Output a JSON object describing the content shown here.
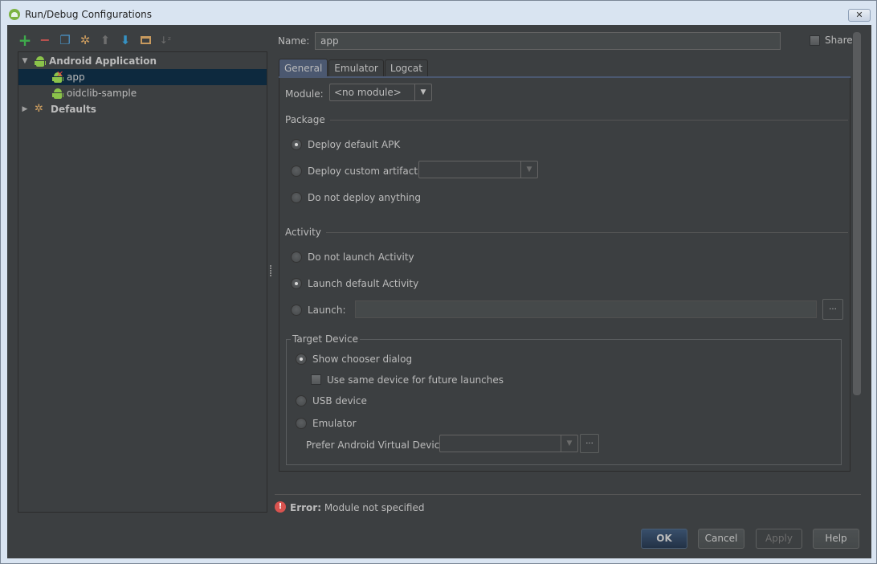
{
  "window": {
    "title": "Run/Debug Configurations",
    "close_label": "✕"
  },
  "toolbar": {
    "items": [
      {
        "name": "add",
        "glyph": "+",
        "color": "#3eaa4b"
      },
      {
        "name": "remove",
        "glyph": "—",
        "color": "#c75450"
      },
      {
        "name": "copy",
        "glyph": "⎘",
        "color": "#4a8fc1"
      },
      {
        "name": "edit-defaults",
        "glyph": "✲",
        "color": "#c89a5e"
      },
      {
        "name": "move-up",
        "glyph": "⬆",
        "color": "#6e6e6e"
      },
      {
        "name": "move-down",
        "glyph": "⬇",
        "color": "#3592c4"
      },
      {
        "name": "folder",
        "glyph": "▭",
        "color": "#c89a5e"
      },
      {
        "name": "sort",
        "glyph": "↓ᶻ",
        "color": "#6e6e6e"
      }
    ]
  },
  "tree": {
    "items": [
      {
        "label": "Android Application",
        "expanded": true,
        "bold": true,
        "level": 0
      },
      {
        "label": "app",
        "level": 1,
        "selected": true,
        "error": true
      },
      {
        "label": "oidclib-sample",
        "level": 1
      },
      {
        "label": "Defaults",
        "expanded": false,
        "bold": true,
        "level": 0
      }
    ]
  },
  "form": {
    "name_label": "Name:",
    "name_value": "app",
    "share_label": "Share",
    "share_checked": false,
    "tabs": [
      {
        "label": "General",
        "active": true
      },
      {
        "label": "Emulator",
        "active": false
      },
      {
        "label": "Logcat",
        "active": false
      }
    ],
    "module_label": "Module:",
    "module_value": "<no module>",
    "package": {
      "title": "Package",
      "options": [
        {
          "label": "Deploy default APK",
          "selected": true
        },
        {
          "label": "Deploy custom artifact:",
          "selected": false
        },
        {
          "label": "Do not deploy anything",
          "selected": false
        }
      ],
      "artifact_value": ""
    },
    "activity": {
      "title": "Activity",
      "options": [
        {
          "label": "Do not launch Activity",
          "selected": false
        },
        {
          "label": "Launch default Activity",
          "selected": true
        },
        {
          "label": "Launch:",
          "selected": false
        }
      ],
      "launch_value": "",
      "browse_label": "..."
    },
    "target_device": {
      "title": "Target Device",
      "options": [
        {
          "label": "Show chooser dialog",
          "selected": true
        },
        {
          "label": "USB device",
          "selected": false
        },
        {
          "label": "Emulator",
          "selected": false
        }
      ],
      "same_device_label": "Use same device for future launches",
      "same_device_checked": false,
      "avd_label": "Prefer Android Virtual Device:",
      "avd_value": "",
      "browse_label": "..."
    }
  },
  "status": {
    "error_prefix": "Error:",
    "error_message": "Module not specified"
  },
  "buttons": {
    "ok": "OK",
    "cancel": "Cancel",
    "apply": "Apply",
    "help": "Help"
  }
}
